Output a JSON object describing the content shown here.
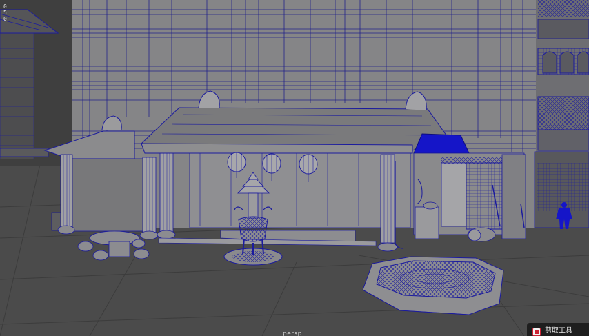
{
  "viewport": {
    "camera_name": "persp",
    "axis_indicator": [
      "0",
      "5",
      "0"
    ]
  },
  "taskbar_popup": {
    "label": "剪取工具",
    "icon": "snipping-tool-icon"
  },
  "colors": {
    "wireframe_blue": "#1b1b9e",
    "selected_blue": "#1515c8",
    "ground": "#4a4a4a",
    "wall": "#848486",
    "roof": "#7a7a7c"
  }
}
